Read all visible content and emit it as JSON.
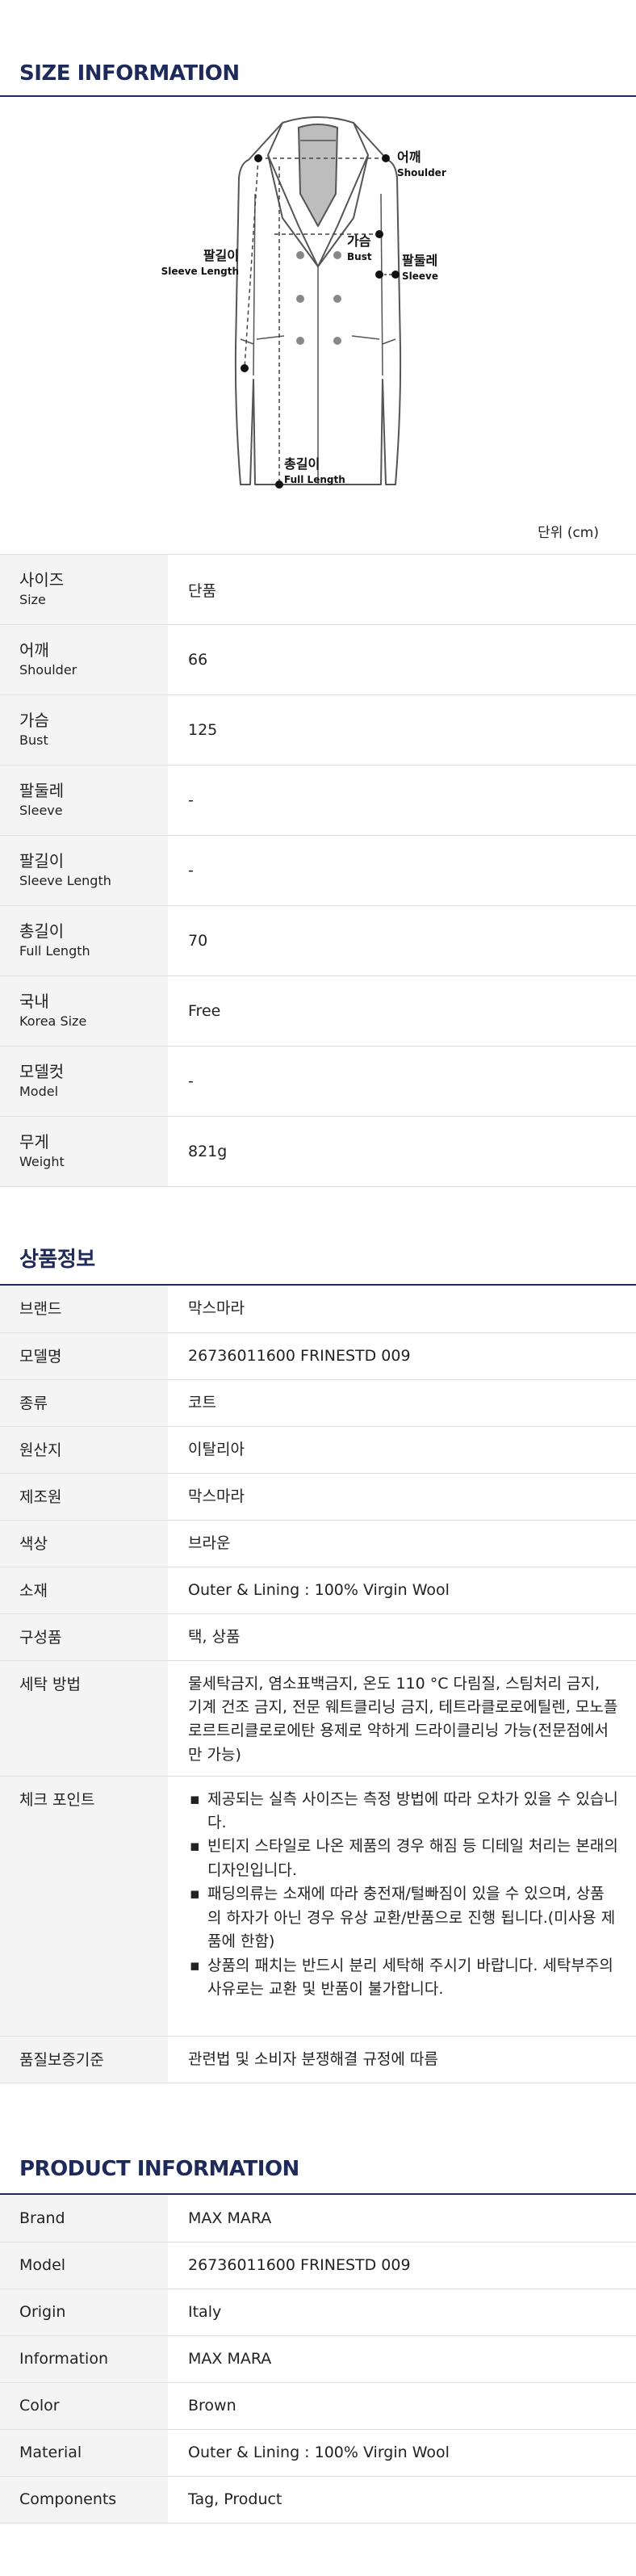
{
  "size_section": {
    "title": "SIZE INFORMATION",
    "unit": "단위 (cm)",
    "diagram_labels": {
      "shoulder_ko": "어깨",
      "shoulder_en": "Shoulder",
      "bust_ko": "가슴",
      "bust_en": "Bust",
      "sleeve_ko": "팔둘레",
      "sleeve_en": "Sleeve",
      "sleeve_length_ko": "팔길이",
      "sleeve_length_en": "Sleeve Length",
      "full_length_ko": "총길이",
      "full_length_en": "Full Length"
    },
    "rows": [
      {
        "ko": "사이즈",
        "en": "Size",
        "value": "단품"
      },
      {
        "ko": "어깨",
        "en": "Shoulder",
        "value": "66"
      },
      {
        "ko": "가슴",
        "en": "Bust",
        "value": "125"
      },
      {
        "ko": "팔둘레",
        "en": "Sleeve",
        "value": "-"
      },
      {
        "ko": "팔길이",
        "en": "Sleeve Length",
        "value": "-"
      },
      {
        "ko": "총길이",
        "en": "Full Length",
        "value": "70"
      },
      {
        "ko": "국내",
        "en": "Korea Size",
        "value": "Free"
      },
      {
        "ko": "모델컷",
        "en": "Model",
        "value": "-"
      },
      {
        "ko": "무게",
        "en": "Weight",
        "value": "821g"
      }
    ]
  },
  "info_section": {
    "title": "상품정보",
    "rows": [
      {
        "key": "브랜드",
        "value": "막스마라"
      },
      {
        "key": "모델명",
        "value": "26736011600 FRINESTD 009"
      },
      {
        "key": "종류",
        "value": "코트"
      },
      {
        "key": "원산지",
        "value": "이탈리아"
      },
      {
        "key": "제조원",
        "value": "막스마라"
      },
      {
        "key": "색상",
        "value": "브라운"
      },
      {
        "key": "소재",
        "value": "Outer & Lining : 100% Virgin Wool"
      },
      {
        "key": "구성품",
        "value": "택, 상품"
      },
      {
        "key": "세탁 방법",
        "value": "물세탁금지, 염소표백금지, 온도 110 °C 다림질, 스팀처리 금지, 기계 건조 금지, 전문 웨트클리닝 금지, 테트라클로로에틸렌, 모노플로르트리클로로에탄 용제로 약하게 드라이클리닝 가능(전문점에서만 가능)"
      },
      {
        "key": "체크 포인트",
        "items": [
          "제공되는 실측 사이즈는 측정 방법에 따라 오차가 있을 수 있습니다.",
          "빈티지 스타일로 나온 제품의 경우 해짐 등 디테일 처리는 본래의 디자인입니다.",
          "패딩의류는 소재에 따라 충전재/털빠짐이 있을 수 있으며, 상품의 하자가 아닌 경우 유상 교환/반품으로 진행 됩니다.(미사용 제품에 한함)",
          "상품의 패치는 반드시 분리 세탁해 주시기 바랍니다. 세탁부주의 사유로는 교환 및 반품이 불가합니다."
        ]
      },
      {
        "key": "품질보증기준",
        "value": "관련법 및 소비자 분쟁해결 규정에 따름"
      }
    ]
  },
  "product_section": {
    "title": "PRODUCT INFORMATION",
    "rows": [
      {
        "key": "Brand",
        "value": "MAX MARA"
      },
      {
        "key": "Model",
        "value": "26736011600 FRINESTD 009"
      },
      {
        "key": "Origin",
        "value": "Italy"
      },
      {
        "key": "Information",
        "value": "MAX MARA"
      },
      {
        "key": "Color",
        "value": "Brown"
      },
      {
        "key": "Material",
        "value": "Outer & Lining : 100% Virgin Wool"
      },
      {
        "key": "Components",
        "value": "Tag, Product"
      }
    ]
  },
  "colors": {
    "title": "#1e2a5a",
    "label_bg": "#f4f4f4",
    "border": "#dedede"
  }
}
